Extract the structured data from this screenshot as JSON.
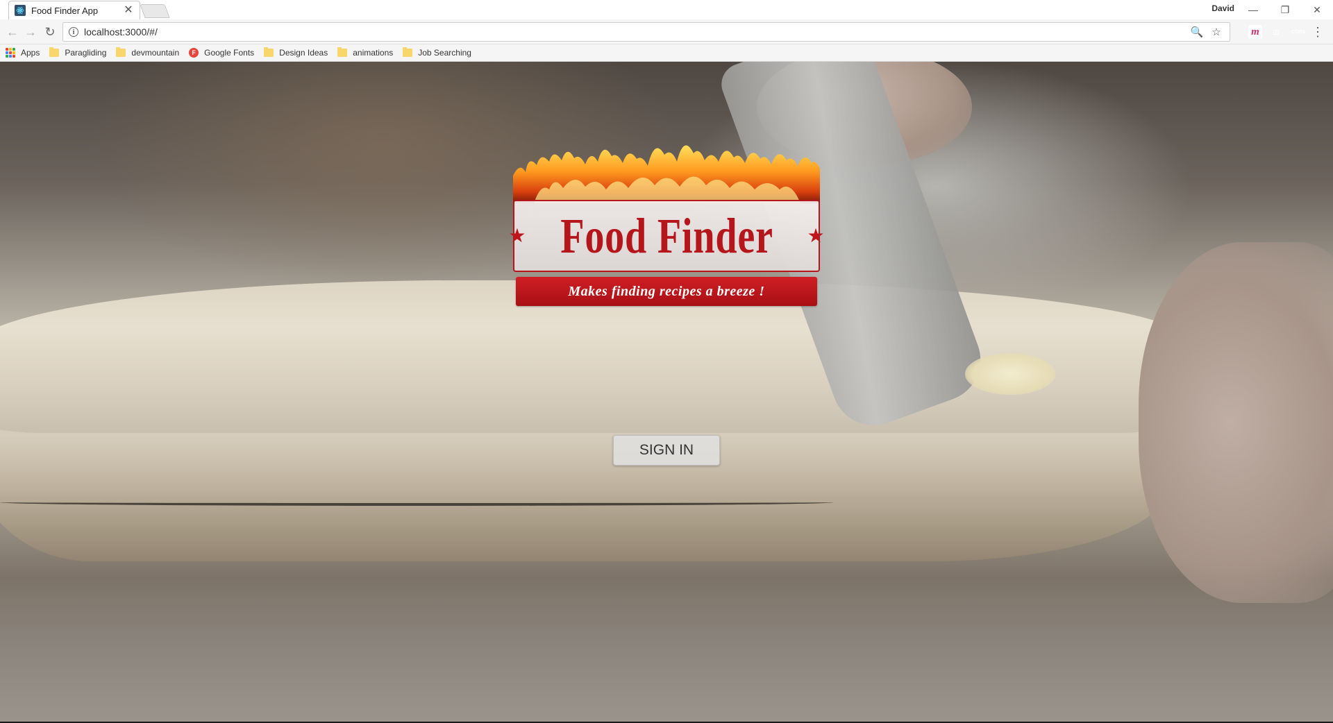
{
  "tab": {
    "title": "Food Finder App",
    "close": "✕"
  },
  "window": {
    "user": "David",
    "minimize": "—",
    "restore": "❐",
    "close": "✕"
  },
  "toolbar": {
    "url": "localhost:3000/#/",
    "back": "←",
    "forward": "→",
    "reload": "↻",
    "zoom": "🔍",
    "star": "☆",
    "menu": "⋮"
  },
  "extensions": [
    {
      "name": "m-extension",
      "label": "m",
      "color": "#d92e6a"
    },
    {
      "name": "red-extension",
      "label": "◫",
      "color": "#c8102e"
    },
    {
      "name": "cors-extension",
      "label": "CORS",
      "color": "#d0322d"
    }
  ],
  "bookmarks": [
    {
      "label": "Apps",
      "icon": "apps-grid-icon"
    },
    {
      "label": "Paragliding",
      "icon": "folder-icon"
    },
    {
      "label": "devmountain",
      "icon": "folder-icon"
    },
    {
      "label": "Google Fonts",
      "icon": "google-fonts-icon"
    },
    {
      "label": "Design Ideas",
      "icon": "folder-icon"
    },
    {
      "label": "animations",
      "icon": "folder-icon"
    },
    {
      "label": "Job Searching",
      "icon": "folder-icon"
    }
  ],
  "logo": {
    "title": "Food Finder",
    "star": "★",
    "tagline": "Makes finding recipes a breeze !"
  },
  "signin": {
    "label": "SIGN IN"
  },
  "colors": {
    "brand_red": "#b5161c",
    "banner_red": "#cf1f24"
  }
}
